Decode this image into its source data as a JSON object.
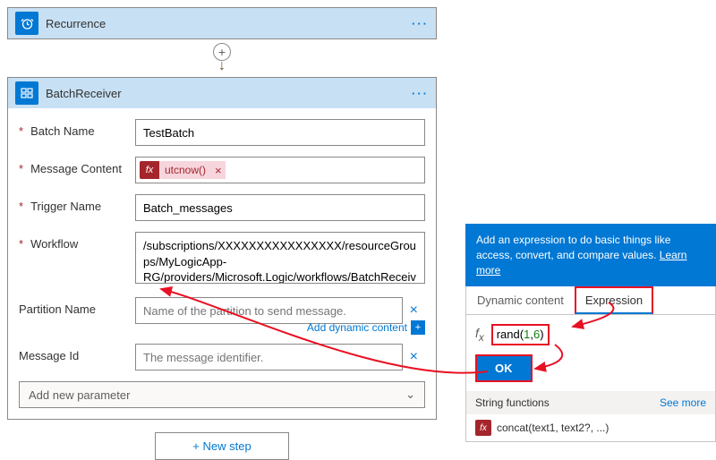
{
  "recurrence": {
    "title": "Recurrence"
  },
  "batch": {
    "title": "BatchReceiver",
    "labels": {
      "batch_name": "Batch Name",
      "message_content": "Message Content",
      "trigger_name": "Trigger Name",
      "workflow": "Workflow",
      "partition_name": "Partition Name",
      "message_id": "Message Id"
    },
    "values": {
      "batch_name": "TestBatch",
      "message_content_token": "utcnow()",
      "trigger_name": "Batch_messages",
      "workflow": "/subscriptions/XXXXXXXXXXXXXXXX/resourceGroups/MyLogicApp-RG/providers/Microsoft.Logic/workflows/BatchReceiver"
    },
    "placeholders": {
      "partition_name": "Name of the partition to send message.",
      "message_id": "The message identifier."
    },
    "dynamic_link": "Add dynamic content",
    "add_param": "Add new parameter",
    "new_step": "+ New step"
  },
  "picker": {
    "tip": "Add an expression to do basic things like access, convert, and compare values.",
    "learn_more": "Learn more",
    "tabs": {
      "dynamic": "Dynamic content",
      "expression": "Expression"
    },
    "expression_value": "rand(1,6)",
    "ok": "OK",
    "section": "String functions",
    "see_more": "See more",
    "func1": "concat(text1, text2?, ...)"
  }
}
